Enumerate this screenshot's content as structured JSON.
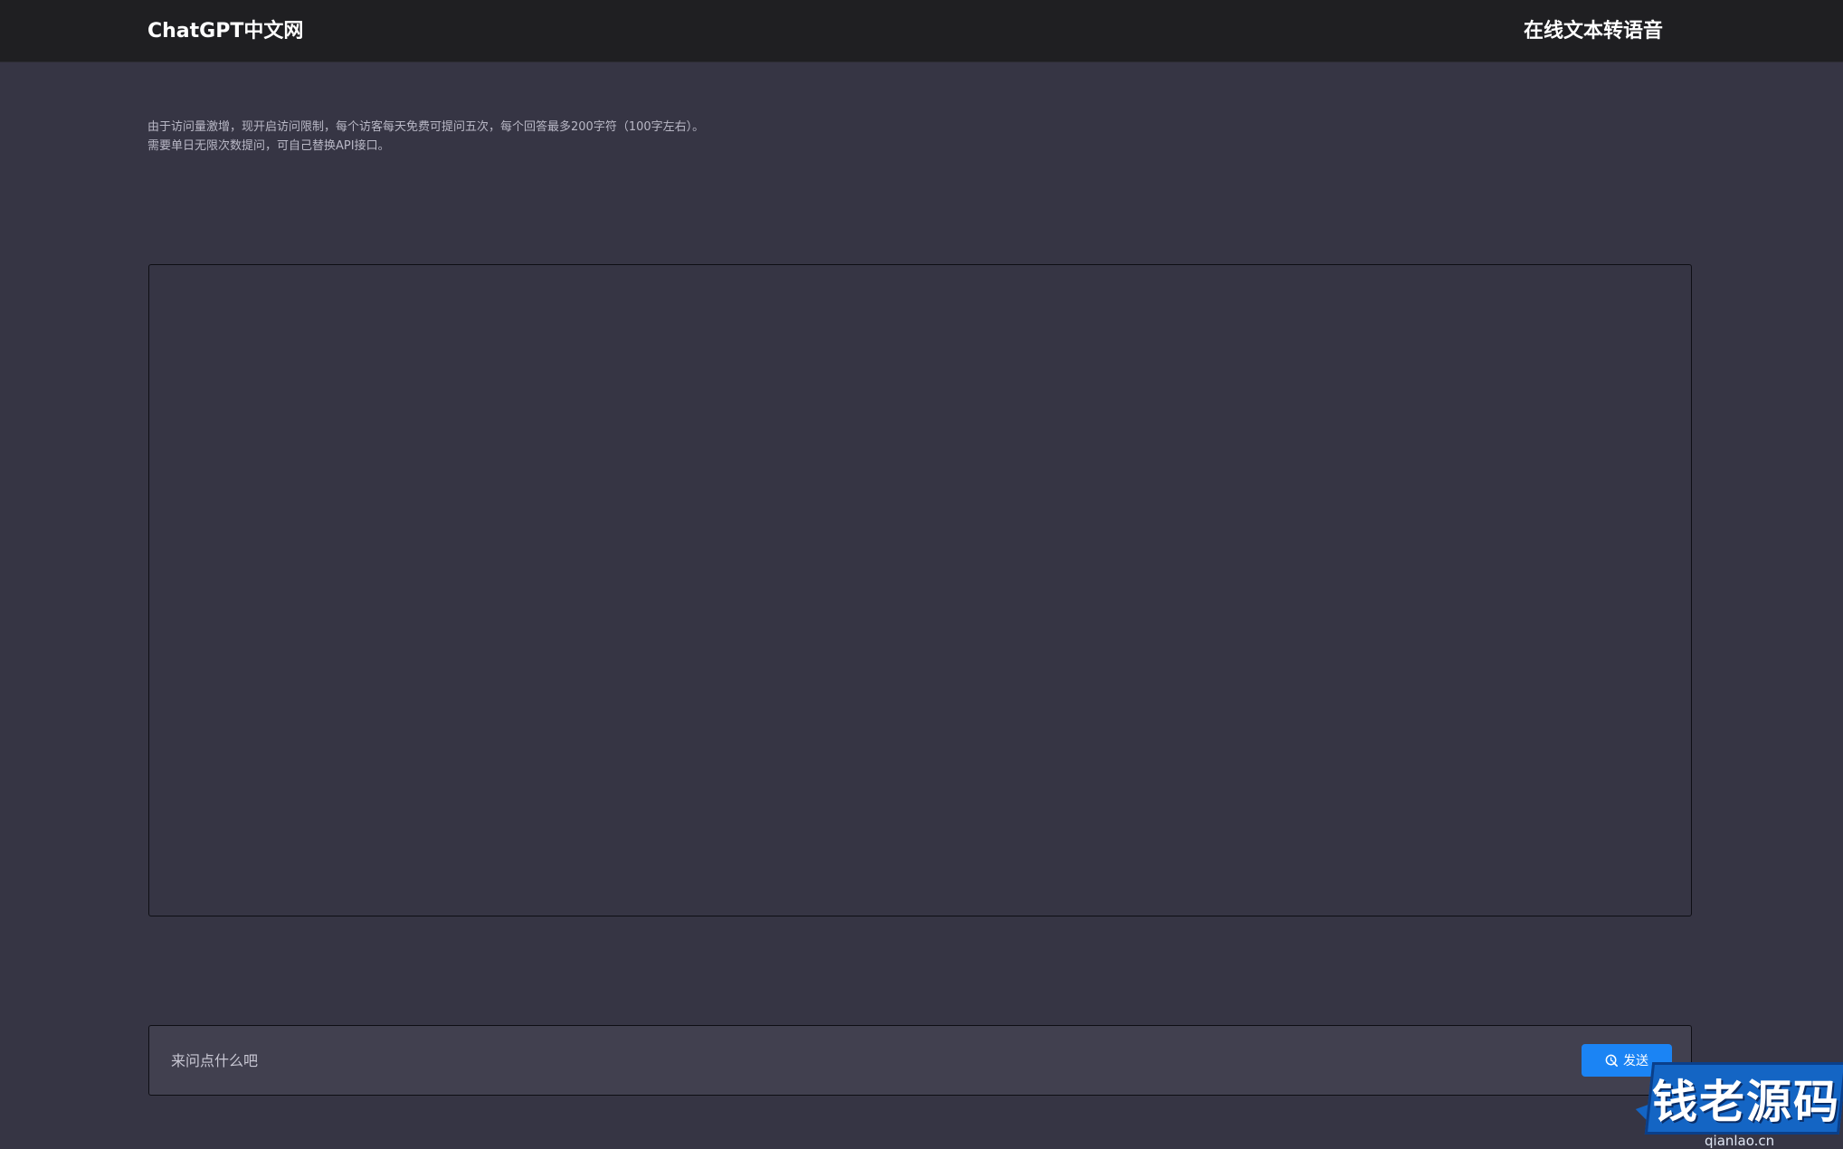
{
  "header": {
    "brand": "ChatGPT中文网",
    "link_label": "在线文本转语音"
  },
  "notice": {
    "line1": "由于访问量激增，现开启访问限制，每个访客每天免费可提问五次，每个回答最多200字符（100字左右）。",
    "line2": "需要单日无限次数提问，可自己替换API接口。"
  },
  "composer": {
    "placeholder": "来问点什么吧",
    "send_label": "发送",
    "send_icon": "send-icon"
  },
  "watermark": {
    "text": "钱老源码",
    "url": "qianlao.cn"
  },
  "colors": {
    "background": "#363544",
    "topbar": "#1f1f22",
    "input_bg": "#41404f",
    "accent": "#1b84f4",
    "watermark_blue": "#1465c4"
  }
}
